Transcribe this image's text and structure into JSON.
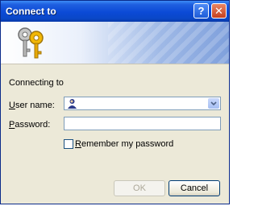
{
  "window": {
    "title": "Connect to"
  },
  "form": {
    "connecting_text": "Connecting to",
    "user_label_u": "U",
    "user_label_rest": "ser name:",
    "password_label_p": "P",
    "password_label_rest": "assword:",
    "user_value": "",
    "password_value": "",
    "remember_label_r": "R",
    "remember_label_rest": "emember my password",
    "remember_checked": false
  },
  "buttons": {
    "ok": "OK",
    "cancel": "Cancel"
  }
}
